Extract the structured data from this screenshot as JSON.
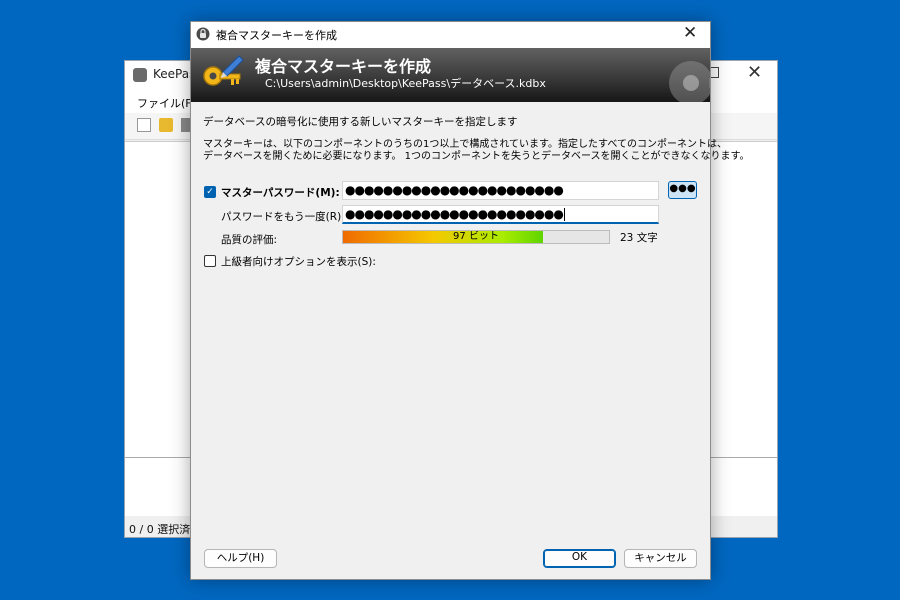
{
  "background_window": {
    "title": "KeePass",
    "menu": {
      "file": "ファイル(F)"
    },
    "status": "0 / 0 選択済"
  },
  "dialog": {
    "window_title": "複合マスターキーを作成",
    "banner": {
      "title": "複合マスターキーを作成",
      "path": "C:\\Users\\admin\\Desktop\\KeePass\\データベース.kdbx"
    },
    "intro": "データベースの暗号化に使用する新しいマスターキーを指定します",
    "description_line1": "マスターキーは、以下のコンポーネントのうちの1つ以上で構成されています。指定したすべてのコンポーネントは、",
    "description_line2": "データベースを開くために必要になります。 1つのコンポーネントを失うとデータベースを開くことができなくなります。",
    "master_password": {
      "checked": true,
      "label": "マスターパスワード(M):",
      "value": "●●●●●●●●●●●●●●●●●●●●●●●",
      "toggle_label": "●●●"
    },
    "repeat_password": {
      "label": "パスワードをもう一度(R):",
      "value": "●●●●●●●●●●●●●●●●●●●●●●●"
    },
    "quality": {
      "label": "品質の評価:",
      "bits_text": "97 ビット",
      "fill_fraction": 0.75,
      "chars_text": "23 文字"
    },
    "advanced_options": {
      "checked": false,
      "label": "上級者向けオプションを表示(S):"
    },
    "buttons": {
      "help": "ヘルプ(H)",
      "ok": "OK",
      "cancel": "キャンセル"
    }
  },
  "colors": {
    "desktop": "#0067c0",
    "accent": "#0063b1",
    "banner_dark": "#161616"
  },
  "icons": {
    "app": "keepass-lock-icon",
    "banner": "key-pen-icon"
  }
}
